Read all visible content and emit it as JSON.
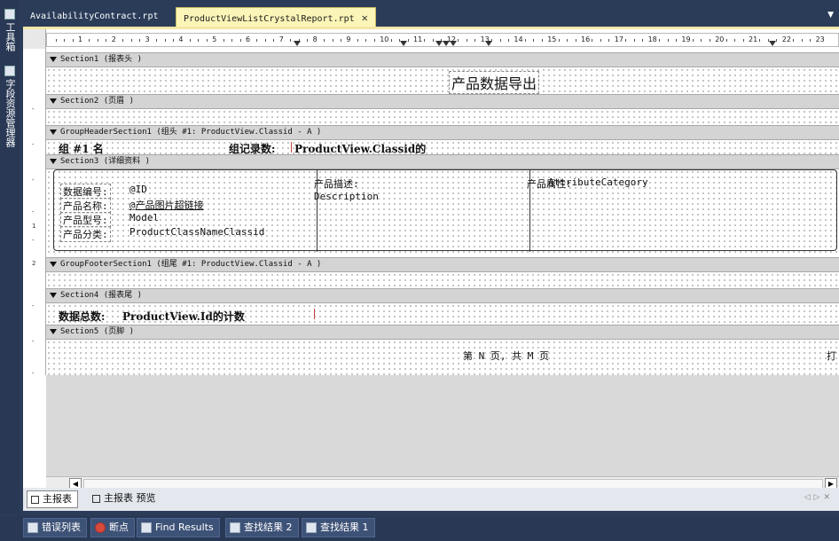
{
  "left_strip": {
    "items": [
      {
        "label": "工具箱",
        "icon": "wrench-icon"
      },
      {
        "label": "字段资源管理器",
        "icon": "field-explorer-icon"
      }
    ]
  },
  "tabs": [
    {
      "label": "AvailabilityContract.rpt",
      "active": false
    },
    {
      "label": "ProductViewListCrystalReport.rpt",
      "active": true
    }
  ],
  "ruler": {
    "numbers": [
      "1",
      "2",
      "3",
      "4",
      "5",
      "6",
      "7",
      "8",
      "9",
      "10",
      "11",
      "12",
      "13",
      "14",
      "15",
      "16",
      "17",
      "18",
      "19",
      "20",
      "21",
      "22",
      "23"
    ]
  },
  "sections": {
    "section1": {
      "header": "Section1 (报表头  )",
      "title": "产品数据导出"
    },
    "section2": {
      "header": "Section2 (页眉  )"
    },
    "group_header": {
      "header": "GroupHeaderSection1 (组头 #1: ProductView.Classid - A )",
      "group_name": "组 #1 名",
      "record_count_label": "组记录数:",
      "record_count_field": "ProductView.Classid的"
    },
    "section3": {
      "header": "Section3 (详细资料  )",
      "rows": [
        {
          "label": "数据编号:",
          "value": "@ID"
        },
        {
          "label": "产品名称:",
          "value": "@产品图片超链接"
        },
        {
          "label": "产品型号:",
          "value": "Model"
        },
        {
          "label": "产品分类:",
          "value": "ProductClassNameClassid"
        }
      ],
      "desc_label": "产品描述:",
      "desc_value": "Description",
      "attr_label": "产品属性:",
      "attr_value": "AttributeCategory"
    },
    "group_footer": {
      "header": "GroupFooterSection1 (组尾 #1: ProductView.Classid - A )"
    },
    "section4": {
      "header": "Section4 (报表尾  )",
      "total_label": "数据总数:",
      "total_field": "ProductView.Id的计数"
    },
    "section5": {
      "header": "Section5 (页脚  )",
      "page_text": "第 N 页, 共 M 页",
      "right_text": "打"
    }
  },
  "view_tabs": [
    {
      "label": "主报表",
      "active": true
    },
    {
      "label": "主报表 预览",
      "active": false
    }
  ],
  "status_tabs": [
    {
      "label": "错误列表",
      "icon": "error-list-icon"
    },
    {
      "label": "断点",
      "icon": "breakpoint-icon"
    },
    {
      "label": "Find Results",
      "icon": "find-results-icon"
    },
    {
      "label": "查找结果 2",
      "icon": "find-results-2-icon"
    },
    {
      "label": "查找结果 1",
      "icon": "find-results-1-icon"
    }
  ]
}
